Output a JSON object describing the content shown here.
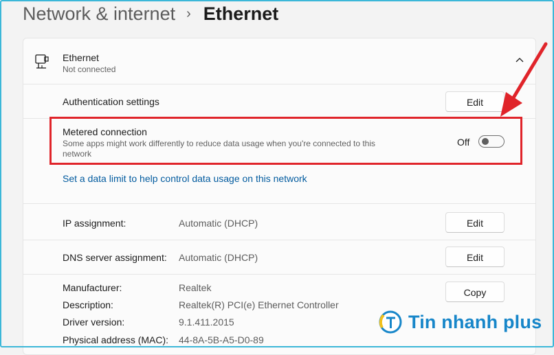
{
  "breadcrumb": {
    "parent": "Network & internet",
    "separator": "›",
    "current": "Ethernet"
  },
  "adapter": {
    "name": "Ethernet",
    "status": "Not connected",
    "icon": "ethernet-icon",
    "expand_icon": "chevron-up-icon"
  },
  "authentication": {
    "label": "Authentication settings",
    "button": "Edit"
  },
  "metered": {
    "label": "Metered connection",
    "description": "Some apps might work differently to reduce data usage when you're connected to this network",
    "toggle_state": "Off"
  },
  "data_limit_link": "Set a data limit to help control data usage on this network",
  "ip_assignment": {
    "label": "IP assignment:",
    "value": "Automatic (DHCP)",
    "button": "Edit"
  },
  "dns_assignment": {
    "label": "DNS server assignment:",
    "value": "Automatic (DHCP)",
    "button": "Edit"
  },
  "properties": {
    "copy_button": "Copy",
    "rows": [
      {
        "label": "Manufacturer:",
        "value": "Realtek"
      },
      {
        "label": "Description:",
        "value": "Realtek(R) PCI(e) Ethernet Controller"
      },
      {
        "label": "Driver version:",
        "value": "9.1.411.2015"
      },
      {
        "label": "Physical address (MAC):",
        "value": "44-8A-5B-A5-D0-89"
      }
    ]
  },
  "watermark": {
    "text": "Tin nhanh plus"
  },
  "colors": {
    "highlight": "#e0242a",
    "link": "#005a9e",
    "brand": "#1786c9",
    "frame": "#3bb7d8"
  }
}
